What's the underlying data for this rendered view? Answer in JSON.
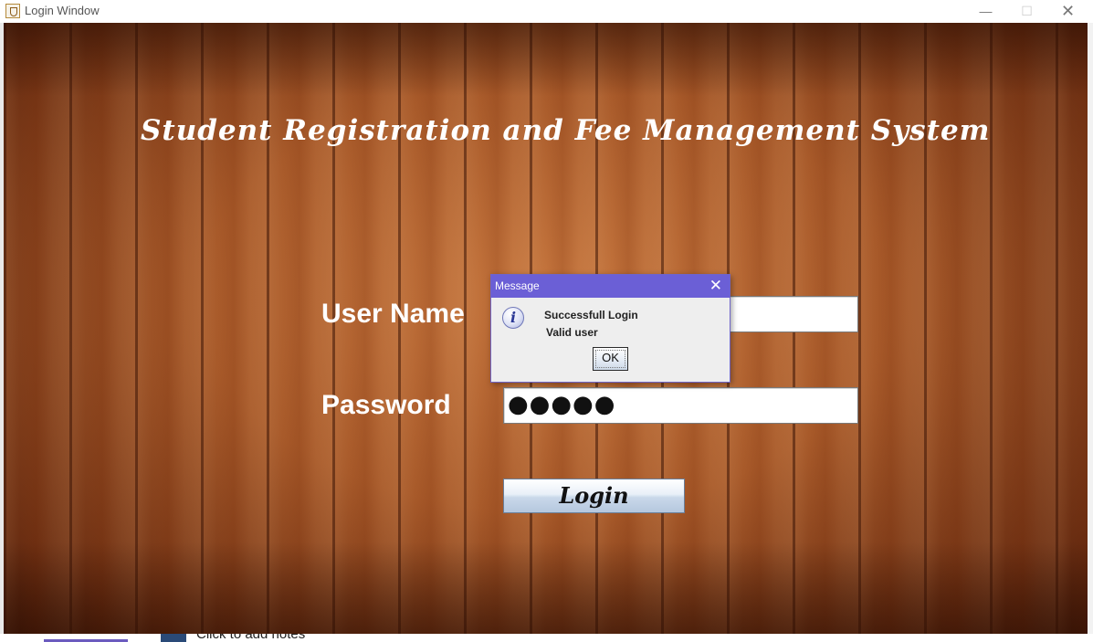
{
  "window": {
    "title": "Login Window",
    "controls": {
      "minimize": "—",
      "maximize": "☐",
      "close": "✕"
    }
  },
  "app": {
    "title": "Student Registration and Fee Management System"
  },
  "form": {
    "username_label": "User Name",
    "username_value": "",
    "password_label": "Password",
    "password_value": "●●●●●",
    "login_button": "Login"
  },
  "dialog": {
    "title": "Message",
    "close": "✕",
    "icon": "info-icon",
    "icon_glyph": "i",
    "line1": "Successfull Login",
    "line2": "Valid user",
    "ok_button": "OK"
  },
  "background_app": {
    "notes_placeholder": "Click to add notes"
  }
}
